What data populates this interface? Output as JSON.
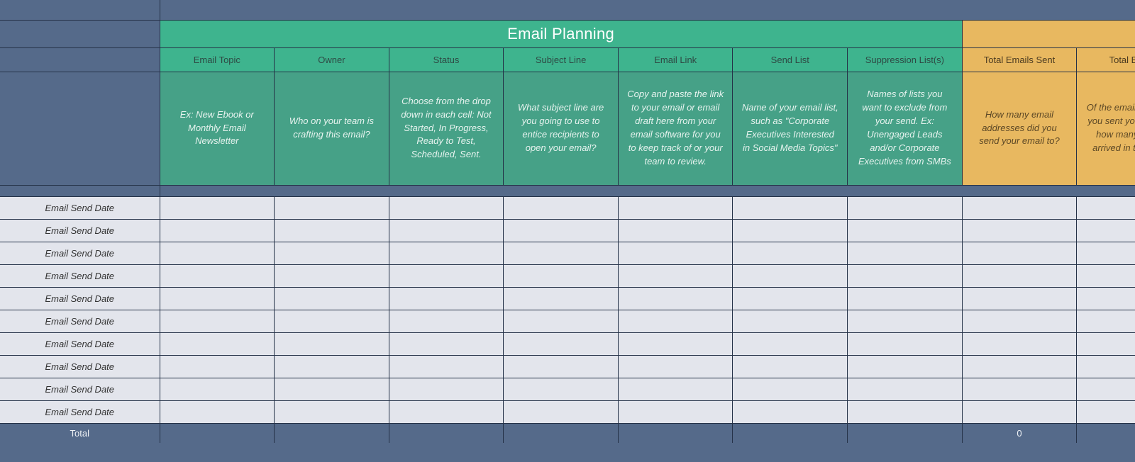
{
  "section_title": "Email Planning",
  "planning": {
    "headers": [
      "Email Topic",
      "Owner",
      "Status",
      "Subject Line",
      "Email Link",
      "Send List",
      "Suppression List(s)"
    ],
    "descriptions": [
      "Ex: New Ebook or Monthly Email Newsletter",
      "Who on your team is crafting this email?",
      "Choose from the drop down in each cell: Not Started, In Progress, Ready to Test, Scheduled, Sent.",
      "What subject line are you going to use to entice recipients to open your email?",
      "Copy and paste the link to your email or email draft here from your email software for you to keep track of or your team to review.",
      "Name of your email list, such as \"Corporate Executives Interested in Social Media Topics\"",
      "Names of lists you want to exclude from your send. Ex: Unengaged Leads and/or Corporate Executives from SMBs"
    ]
  },
  "results": {
    "headers": [
      "Total Emails Sent",
      "Total Emails"
    ],
    "descriptions": [
      "How many email addresses did you send your email to?",
      "Of the email addresses you sent your email to, how many actually arrived in the inbox?"
    ]
  },
  "row_label": "Email Send Date",
  "rows": [
    {
      "values": [
        "",
        "",
        "",
        "",
        "",
        "",
        "",
        "",
        ""
      ]
    },
    {
      "values": [
        "",
        "",
        "",
        "",
        "",
        "",
        "",
        "",
        ""
      ]
    },
    {
      "values": [
        "",
        "",
        "",
        "",
        "",
        "",
        "",
        "",
        ""
      ]
    },
    {
      "values": [
        "",
        "",
        "",
        "",
        "",
        "",
        "",
        "",
        ""
      ]
    },
    {
      "values": [
        "",
        "",
        "",
        "",
        "",
        "",
        "",
        "",
        ""
      ]
    },
    {
      "values": [
        "",
        "",
        "",
        "",
        "",
        "",
        "",
        "",
        ""
      ]
    },
    {
      "values": [
        "",
        "",
        "",
        "",
        "",
        "",
        "",
        "",
        ""
      ]
    },
    {
      "values": [
        "",
        "",
        "",
        "",
        "",
        "",
        "",
        "",
        ""
      ]
    },
    {
      "values": [
        "",
        "",
        "",
        "",
        "",
        "",
        "",
        "",
        ""
      ]
    },
    {
      "values": [
        "",
        "",
        "",
        "",
        "",
        "",
        "",
        "",
        ""
      ]
    }
  ],
  "total": {
    "label": "Total",
    "values": [
      "",
      "",
      "",
      "",
      "",
      "",
      "",
      "0",
      ""
    ]
  }
}
